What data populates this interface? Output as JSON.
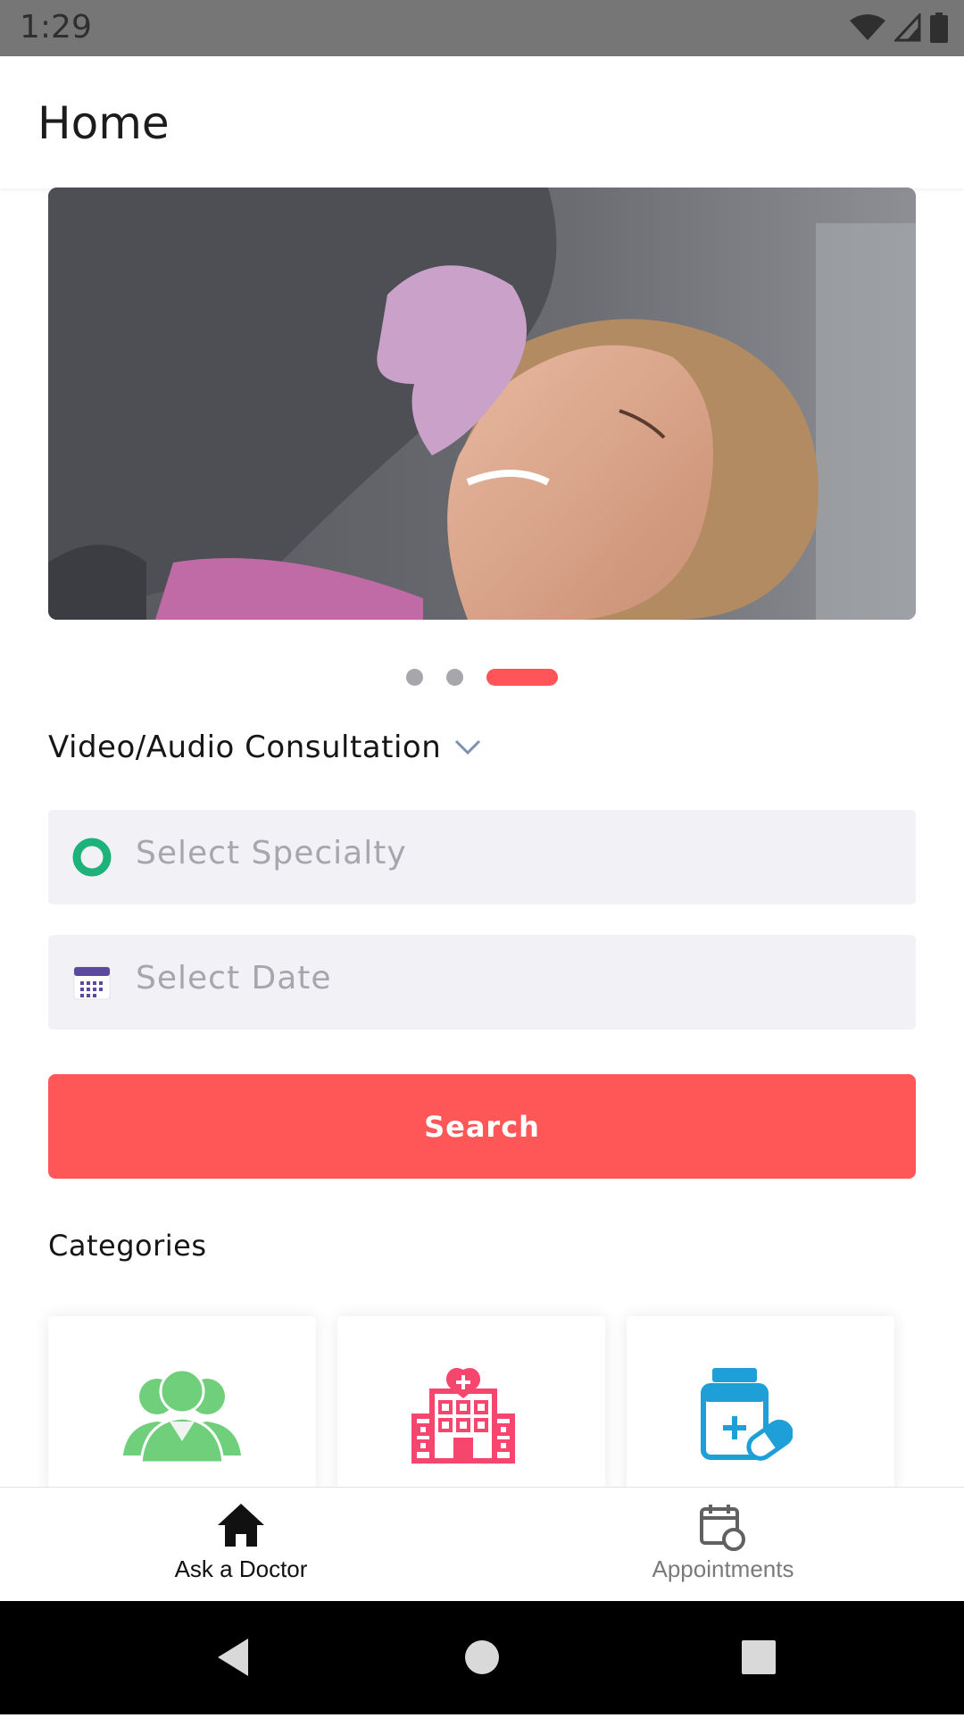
{
  "status_bar": {
    "time": "1:29"
  },
  "app_bar": {
    "title": "Home"
  },
  "carousel": {
    "page_count": 3,
    "active_index": 2
  },
  "consultation": {
    "label": "Video/Audio Consultation"
  },
  "fields": {
    "specialty_placeholder": "Select Specialty",
    "date_placeholder": "Select Date"
  },
  "search": {
    "label": "Search"
  },
  "categories": {
    "title": "Categories",
    "items": [
      {
        "icon": "doctors-icon",
        "color": "#6fcf7a"
      },
      {
        "icon": "hospital-icon",
        "color": "#f7466e"
      },
      {
        "icon": "medicine-icon",
        "color": "#1f9fd8"
      }
    ]
  },
  "bottom_nav": {
    "items": [
      {
        "label": "Ask a Doctor",
        "icon": "home-icon",
        "active": true
      },
      {
        "label": "Appointments",
        "icon": "calendar-clock-icon",
        "active": false
      }
    ]
  },
  "colors": {
    "accent": "#ff5657",
    "field_bg": "#f1f1f6",
    "placeholder": "#a6a6ad",
    "specialty_ring": "#1db27a",
    "calendar_purple": "#5b4aa0"
  }
}
